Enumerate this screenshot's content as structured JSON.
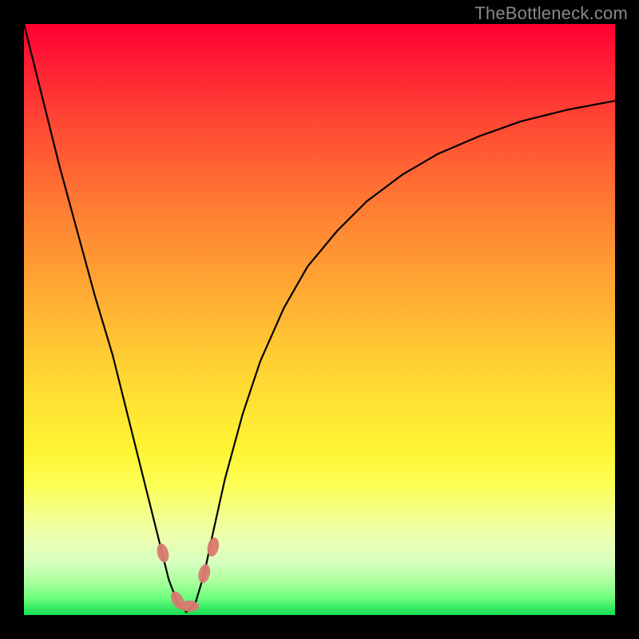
{
  "watermark": "TheBottleneck.com",
  "colors": {
    "frame": "#000000",
    "curve": "#000000",
    "marker": "#d97a70",
    "gradient_top": "#ff0033",
    "gradient_bottom": "#18dd55"
  },
  "chart_data": {
    "type": "line",
    "title": "",
    "xlabel": "",
    "ylabel": "",
    "xlim": [
      0,
      100
    ],
    "ylim": [
      0,
      100
    ],
    "grid": false,
    "legend": false,
    "note": "No axis tick labels or numeric annotations are visible. x and y values are estimated as percentages of the plot area (0 = left/bottom, 100 = right/top).",
    "series": [
      {
        "name": "curve",
        "x": [
          0,
          3,
          6,
          9,
          12,
          15,
          17,
          19,
          21,
          23,
          24.5,
          26,
          27.5,
          29,
          30.5,
          32,
          34,
          37,
          40,
          44,
          48,
          53,
          58,
          64,
          70,
          77,
          84,
          92,
          100
        ],
        "y": [
          100,
          88,
          76,
          65,
          54,
          44,
          36,
          28,
          20,
          12,
          6,
          2,
          0.5,
          2,
          7,
          14,
          23,
          34,
          43,
          52,
          59,
          65,
          70,
          74.5,
          78,
          81,
          83.5,
          85.5,
          87
        ]
      }
    ],
    "markers": [
      {
        "x": 23.5,
        "y": 10.5
      },
      {
        "x": 26.0,
        "y": 2.5
      },
      {
        "x": 28.0,
        "y": 1.5
      },
      {
        "x": 30.5,
        "y": 7.0
      },
      {
        "x": 32.0,
        "y": 11.5
      }
    ]
  }
}
